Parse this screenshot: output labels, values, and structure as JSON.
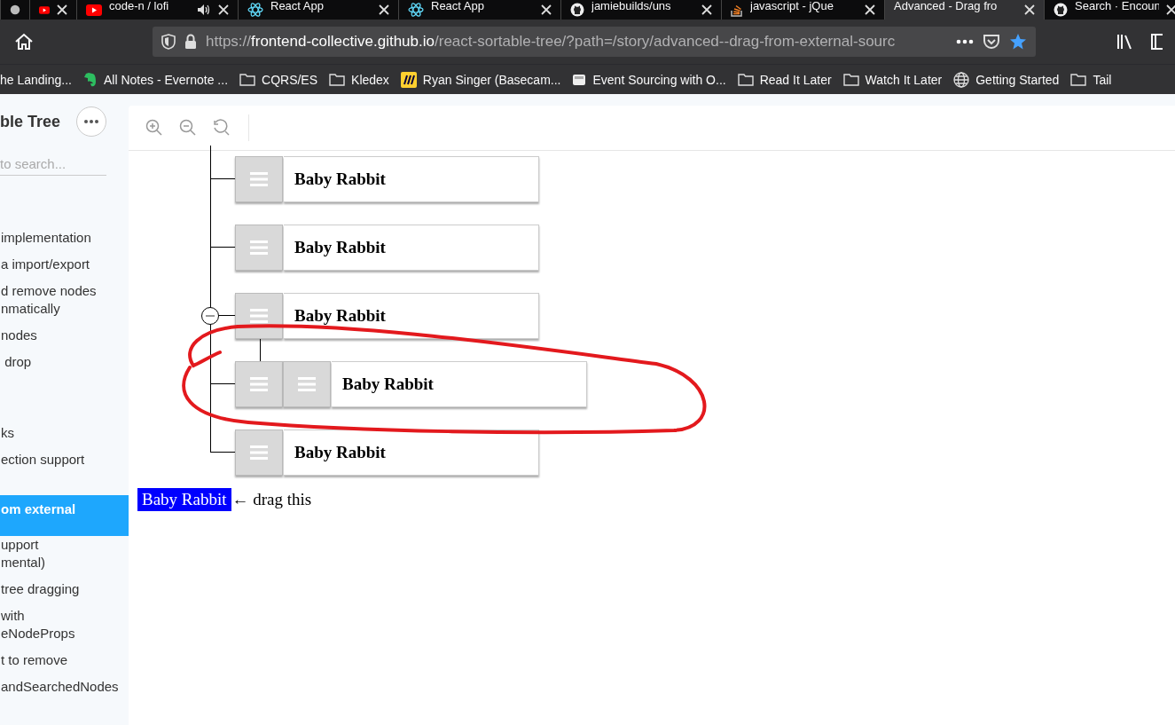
{
  "browser": {
    "tabs": [
      {
        "kind": "generic",
        "selected": false
      },
      {
        "kind": "youtube",
        "selected": false
      },
      {
        "kind": "youtube",
        "title": "code-n / lofi",
        "audio": true,
        "selected": false
      },
      {
        "kind": "react",
        "title": "React App",
        "selected": false
      },
      {
        "kind": "react",
        "title": "React App",
        "selected": false
      },
      {
        "kind": "github",
        "title": "jamiebuilds/uns",
        "selected": false
      },
      {
        "kind": "stackoverflow",
        "title": "javascript - jQue",
        "selected": false
      },
      {
        "kind": "generic-none",
        "title": "Advanced - Drag fro",
        "selected": true
      },
      {
        "kind": "github",
        "title": "Search · Encoun",
        "selected": false
      }
    ],
    "url": {
      "scheme": "https://",
      "host": "frontend-collective.github.io",
      "path": "/react-sortable-tree/?path=/story/advanced--drag-from-external-sourc"
    },
    "bookmarked": true,
    "bookmarks": [
      {
        "kind": "none",
        "label": "he Landing..."
      },
      {
        "kind": "evernote",
        "label": "All Notes - Evernote ..."
      },
      {
        "kind": "folder",
        "label": "CQRS/ES"
      },
      {
        "kind": "folder",
        "label": "Kledex"
      },
      {
        "kind": "miro",
        "label": "Ryan Singer (Basecam..."
      },
      {
        "kind": "page",
        "label": "Event Sourcing with O..."
      },
      {
        "kind": "folder",
        "label": "Read It Later"
      },
      {
        "kind": "folder",
        "label": "Watch It Later"
      },
      {
        "kind": "globe",
        "label": "Getting Started"
      },
      {
        "kind": "folder",
        "label": "Tail"
      }
    ]
  },
  "sidebar": {
    "title": "ble Tree",
    "search": {
      "placeholder": "to search..."
    },
    "items": [
      {
        "label": "implementation",
        "selected": false
      },
      {
        "label": "a import/export",
        "selected": false
      },
      {
        "label": "d remove nodes\nnmatically",
        "selected": false
      },
      {
        "label": "nodes",
        "selected": false
      },
      {
        "label": " drop",
        "selected": false
      },
      {
        "label": "ks",
        "selected": false
      },
      {
        "label": "ection support",
        "selected": false
      },
      {
        "label": "om external",
        "selected": true
      },
      {
        "label": "upport\nmental)",
        "selected": false
      },
      {
        "label": "tree dragging",
        "selected": false
      },
      {
        "label": "with\neNodeProps",
        "selected": false
      },
      {
        "label": "t to remove",
        "selected": false
      },
      {
        "label": "andSearchedNodes",
        "selected": false
      }
    ]
  },
  "tree": {
    "nodes": [
      {
        "kind": "node",
        "title": "Baby Rabbit"
      },
      {
        "kind": "node",
        "title": "Baby Rabbit"
      },
      {
        "kind": "node",
        "title": "Baby Rabbit",
        "expanded": true
      },
      {
        "kind": "drop-preview",
        "title": "Baby Rabbit"
      },
      {
        "kind": "node",
        "title": "Baby Rabbit"
      }
    ]
  },
  "external_source": {
    "label": "Baby Rabbit",
    "hint": "← drag this"
  }
}
